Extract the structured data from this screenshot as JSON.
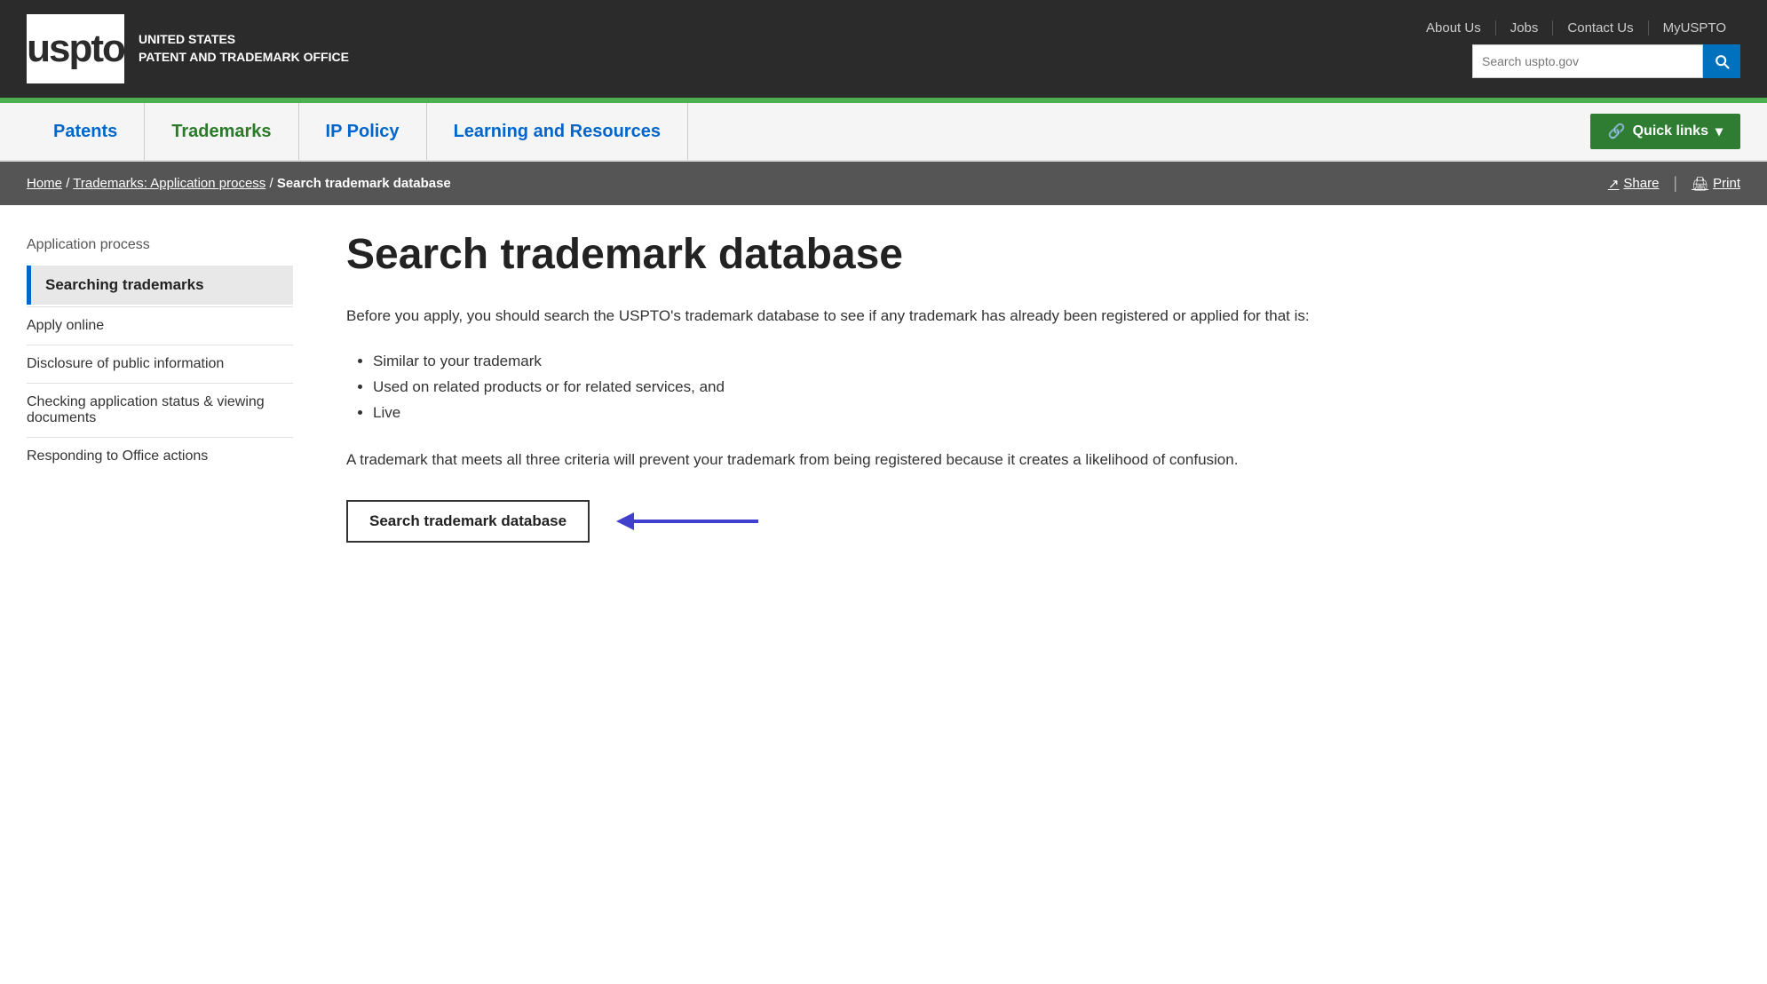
{
  "topBar": {
    "logoText": "uspto",
    "orgLine1": "UNITED STATES",
    "orgLine2": "PATENT AND TRADEMARK OFFICE",
    "links": [
      {
        "label": "About Us",
        "id": "about-us"
      },
      {
        "label": "Jobs",
        "id": "jobs"
      },
      {
        "label": "Contact Us",
        "id": "contact-us"
      },
      {
        "label": "MyUSPTO",
        "id": "myuspto"
      }
    ],
    "searchPlaceholder": "Search uspto.gov"
  },
  "nav": {
    "items": [
      {
        "label": "Patents",
        "id": "patents",
        "active": false
      },
      {
        "label": "Trademarks",
        "id": "trademarks",
        "active": true
      },
      {
        "label": "IP Policy",
        "id": "ip-policy",
        "active": false
      },
      {
        "label": "Learning and Resources",
        "id": "learning",
        "active": false
      }
    ],
    "quickLinksLabel": "Quick links"
  },
  "breadcrumb": {
    "home": "Home",
    "section": "Trademarks: Application process",
    "current": "Search trademark database",
    "shareLabel": "Share",
    "printLabel": "Print"
  },
  "sidebar": {
    "topLink": "Application process",
    "activeItem": "Searching trademarks",
    "links": [
      "Apply online",
      "Disclosure of public information",
      "Checking application status & viewing documents",
      "Responding to Office actions"
    ]
  },
  "page": {
    "title": "Search trademark database",
    "introParagraph": "Before you apply, you should search the USPTO's trademark database to see if any trademark has already been registered or applied for that is:",
    "bullets": [
      "Similar to your trademark",
      "Used on related products or for related services, and",
      "Live"
    ],
    "summaryText": "A trademark that meets all three criteria will prevent your trademark from being registered because it creates a likelihood of confusion.",
    "ctaButtonLabel": "Search trademark database"
  }
}
